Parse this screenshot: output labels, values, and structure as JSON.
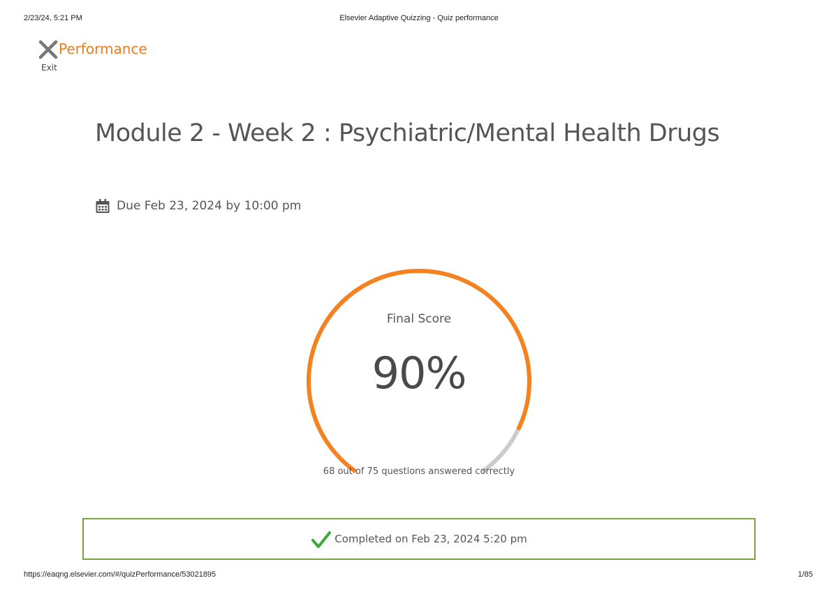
{
  "print_header": {
    "date": "2/23/24, 5:21 PM",
    "title": "Elsevier Adaptive Quizzing - Quiz performance"
  },
  "print_footer": {
    "url": "https://eaqng.elsevier.com/#/quizPerformance/53021895",
    "page": "1/85"
  },
  "header": {
    "title": "Performance",
    "exit_label": "Exit"
  },
  "quiz": {
    "title": "Module 2 - Week 2 : Psychiatric/Mental Health Drugs",
    "due": "Due Feb 23, 2024 by 10:00 pm"
  },
  "score": {
    "label": "Final Score",
    "percent_text": "90%",
    "fraction": 0.9,
    "detail": "68 out of 75 questions answered correctly"
  },
  "completion": {
    "text": "Completed on Feb 23, 2024 5:20 pm"
  },
  "colors": {
    "accent": "#f5821f",
    "track": "#cccccc",
    "success": "#3aa935",
    "banner_border": "#7ba23f"
  },
  "icons": {
    "exit": "close-icon",
    "due": "calendar-icon",
    "completed": "checkmark-icon"
  }
}
